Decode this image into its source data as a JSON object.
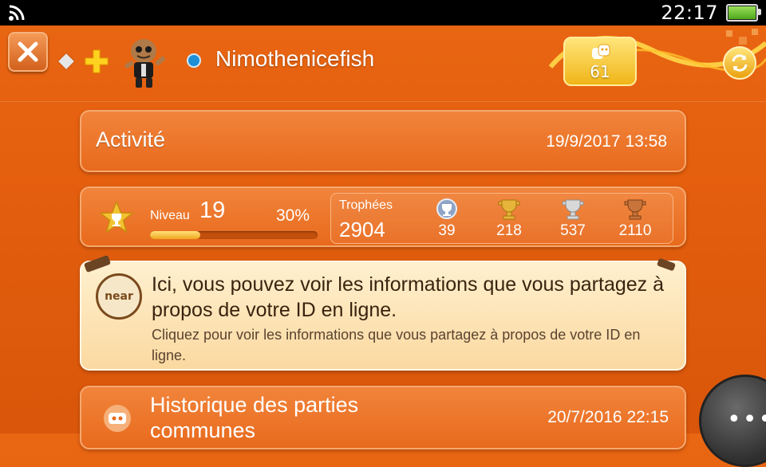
{
  "status_bar": {
    "time": "22:17",
    "wifi_icon": "wifi-icon",
    "battery_icon": "battery-full-icon"
  },
  "header": {
    "close_icon": "close-icon",
    "username": "Nimothenicefish",
    "online_status_color": "#1e8fd6",
    "friends_count": "61",
    "refresh_icon": "refresh-icon"
  },
  "activity": {
    "title": "Activité",
    "date": "19/9/2017 13:58"
  },
  "level": {
    "label": "Niveau",
    "value": "19",
    "percent_text": "30%",
    "progress": 0.3,
    "trophies_label": "Trophées",
    "trophies_total": "2904",
    "trophies": [
      {
        "type": "platinum",
        "count": "39",
        "color": "#b8c6e0"
      },
      {
        "type": "gold",
        "count": "218",
        "color": "#e7b43a"
      },
      {
        "type": "silver",
        "count": "537",
        "color": "#d8d8d8"
      },
      {
        "type": "bronze",
        "count": "2110",
        "color": "#c8743a"
      }
    ]
  },
  "near": {
    "icon_text": "near",
    "title": "Ici, vous pouvez voir les informations que vous partagez à propos de votre ID en ligne.",
    "subtitle": "Cliquez pour voir les informations que vous partagez à propos de votre ID en ligne."
  },
  "history": {
    "title": "Historique des parties communes",
    "date": "20/7/2016 22:15"
  },
  "colors": {
    "background": "#e45f0e",
    "card": "#e86a1d",
    "near_card": "#fbd9a0",
    "accent_gold": "#f0b518"
  }
}
